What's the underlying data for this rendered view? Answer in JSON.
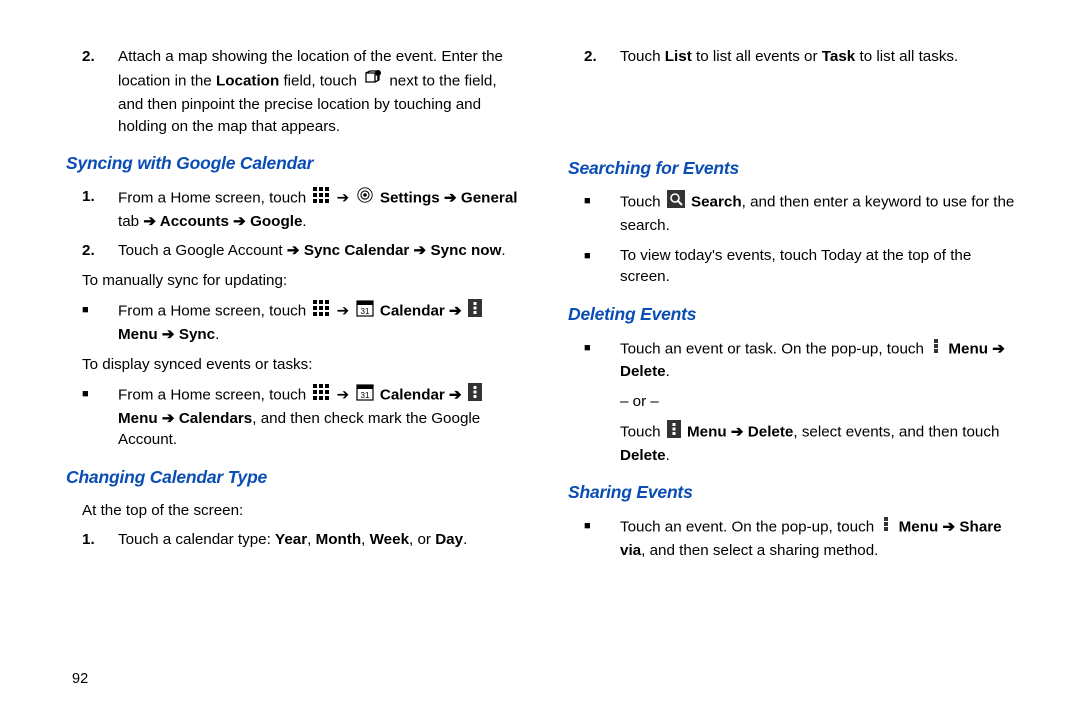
{
  "step2": {
    "num": "2.",
    "t1": "Attach a map showing the location of the event. Enter the location in the ",
    "b1": "Location",
    "t2": " field, touch ",
    "t3": " next to the field, and then pinpoint the precise location by touching and holding on the map that appears."
  },
  "h_sync": "Syncing with Google Calendar",
  "sync1": {
    "num": "1.",
    "t1": "From a Home screen, touch ",
    "arrow": " ➔ ",
    "b_settings": " Settings ➔ General",
    "t_tab": " tab",
    "b_acc": " ➔ Accounts ➔ Google",
    "dot": "."
  },
  "sync2": {
    "num": "2.",
    "t1": "Touch a Google Account",
    "b1": " ➔ Sync Calendar ➔ Sync now",
    "dot": "."
  },
  "sync_manual": "To manually sync for updating:",
  "sync_b1": {
    "t1": "From a Home screen, touch ",
    "arrow": " ➔ ",
    "b_cal": " Calendar ➔ ",
    "b_menu": " Menu ➔ Sync",
    "dot": "."
  },
  "sync_display": "To display synced events or tasks:",
  "sync_b2": {
    "t1": "From a Home screen, touch ",
    "arrow": " ➔ ",
    "b_cal": " Calendar ➔ ",
    "b_menu": " Menu ➔ Calendars",
    "t2": ", and then check mark the Google Account."
  },
  "h_change": "Changing Calendar Type",
  "change_intro": "At the top of the screen:",
  "change1": {
    "num": "1.",
    "t1": "Touch a calendar type: ",
    "b1": "Year",
    "c": ", ",
    "b2": "Month",
    "b3": "Week",
    "or": ", or ",
    "b4": "Day",
    "dot": "."
  },
  "change2": {
    "num": "2.",
    "t1": "Touch ",
    "b1": "List",
    "t2": " to list all events or ",
    "b2": "Task",
    "t3": " to list all tasks."
  },
  "h_search": "Searching for Events",
  "search_b1": {
    "t1": "Touch ",
    "b1": " Search",
    "t2": ", and then enter a keyword to use for the search."
  },
  "search_b2": {
    "t1": "To view today's events, touch Today at the top of the screen."
  },
  "h_delete": "Deleting Events",
  "delete_b1": {
    "t1": "Touch an event or task. On the pop-up, touch ",
    "b1": " Menu ➔ Delete",
    "dot": "."
  },
  "delete_or": "– or –",
  "delete_alt": {
    "t1": "Touch ",
    "b1": " Menu ➔ Delete",
    "t2": ", select events, and then touch ",
    "b2": "Delete",
    "dot": "."
  },
  "h_share": "Sharing Events",
  "share_b1": {
    "t1": "Touch an event. On the pop-up, touch ",
    "b1": " Menu ➔ Share via",
    "t2": ", and then select a sharing method."
  },
  "pagenum": "92"
}
